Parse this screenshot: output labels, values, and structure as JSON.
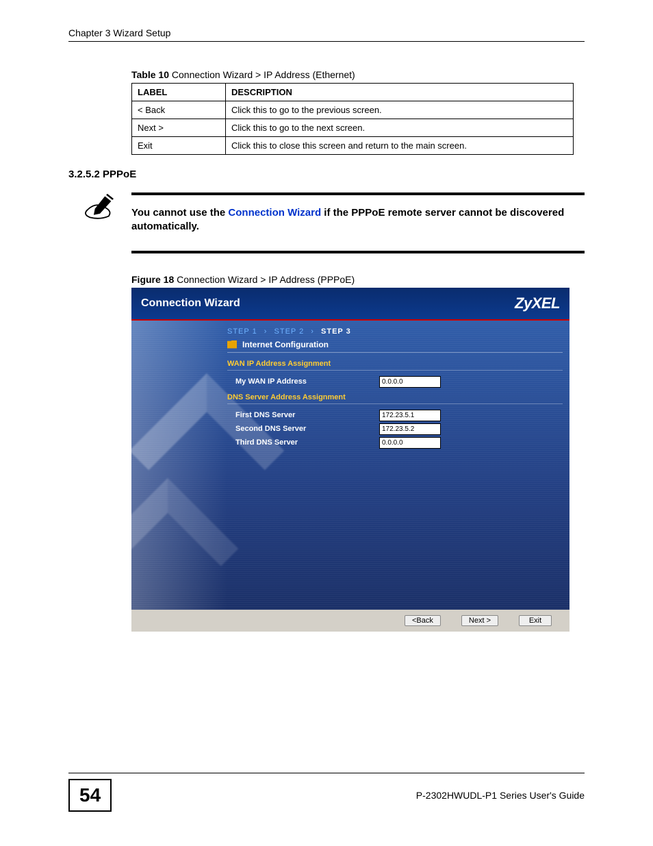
{
  "header": {
    "chapter": "Chapter 3 Wizard Setup"
  },
  "table": {
    "caption_prefix": "Table 10",
    "caption_text": "   Connection Wizard > IP Address (Ethernet)",
    "headers": {
      "label": "LABEL",
      "description": "DESCRIPTION"
    },
    "rows": [
      {
        "label": "< Back",
        "description": "Click this to go to the previous screen."
      },
      {
        "label": "Next >",
        "description": "Click this to go to the next screen."
      },
      {
        "label": "Exit",
        "description": "Click this to close this screen and return to the main screen."
      }
    ]
  },
  "section_heading": "3.2.5.2  PPPoE",
  "note": {
    "pre": "You cannot use the ",
    "link": "Connection Wizard",
    "post": " if the PPPoE remote server cannot be discovered automatically."
  },
  "figure": {
    "caption_prefix": "Figure 18",
    "caption_text": "   Connection Wizard > IP Address (PPPoE)"
  },
  "wizard": {
    "title": "Connection Wizard",
    "brand": "ZyXEL",
    "steps": {
      "s1": "STEP 1",
      "s2": "STEP 2",
      "s3": "STEP 3",
      "arrow": "›"
    },
    "panel_title": "Internet Configuration",
    "wan_section": "WAN IP Address Assignment",
    "my_wan_label": "My WAN IP Address",
    "my_wan_value": "0.0.0.0",
    "dns_section": "DNS Server Address Assignment",
    "dns1_label": "First DNS Server",
    "dns1_value": "172.23.5.1",
    "dns2_label": "Second DNS Server",
    "dns2_value": "172.23.5.2",
    "dns3_label": "Third DNS Server",
    "dns3_value": "0.0.0.0",
    "btn_back": "<Back",
    "btn_next": "Next >",
    "btn_exit": "Exit"
  },
  "footer": {
    "page_number": "54",
    "guide": "P-2302HWUDL-P1 Series User's Guide"
  }
}
